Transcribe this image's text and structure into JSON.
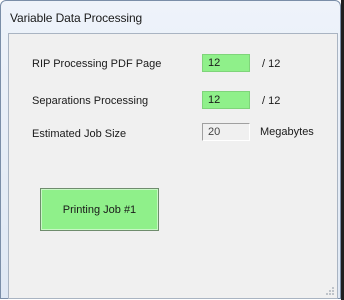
{
  "window": {
    "title": "Variable Data Processing"
  },
  "fields": {
    "rip_label": "RIP Processing PDF Page",
    "rip_value": "12",
    "rip_total": "/ 12",
    "sep_label": "Separations Processing",
    "sep_value": "12",
    "sep_total": "/ 12",
    "size_label": "Estimated Job Size",
    "size_value": "20",
    "size_unit": "Megabytes"
  },
  "actions": {
    "print_label": "Printing Job #1"
  },
  "colors": {
    "progress_green": "#8ff08a"
  }
}
